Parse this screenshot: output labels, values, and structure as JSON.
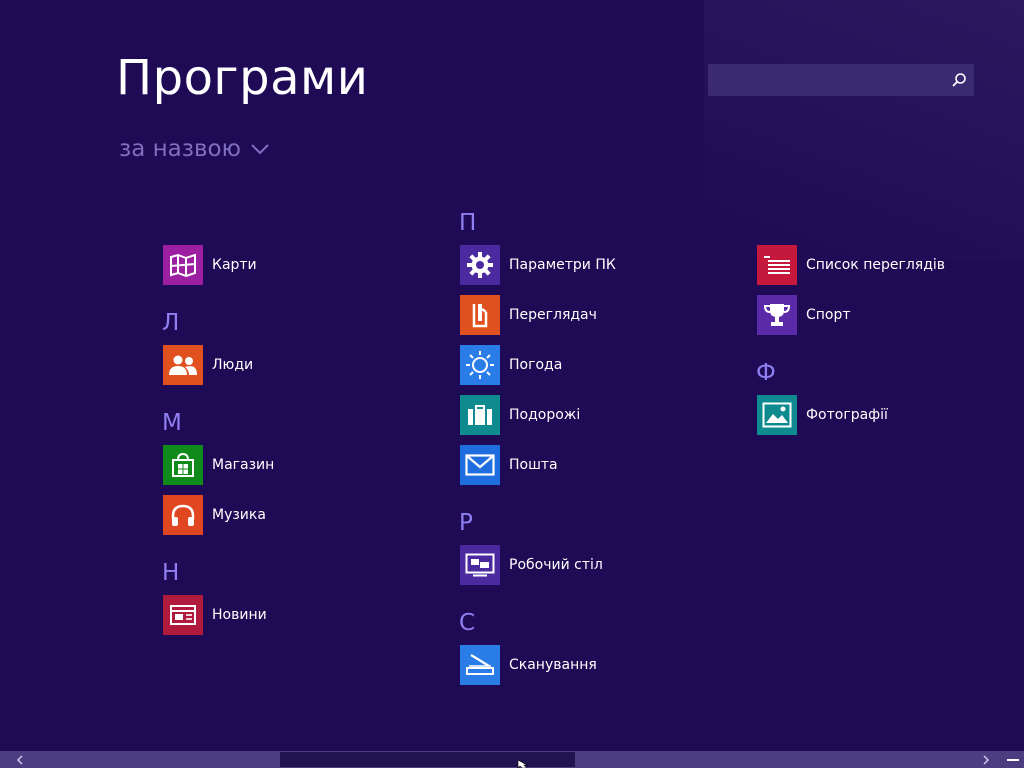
{
  "header": {
    "title": "Програми",
    "sort_label": "за назвою"
  },
  "search": {
    "placeholder": "",
    "icon": "search-icon"
  },
  "groups": {
    "l": "Л",
    "m": "М",
    "n": "Н",
    "p": "П",
    "r": "Р",
    "s": "С",
    "f": "Ф"
  },
  "apps": {
    "karty": {
      "label": "Карти",
      "color": "#9b1fa0",
      "icon": "maps-icon"
    },
    "lyudy": {
      "label": "Люди",
      "color": "#e0511f",
      "icon": "people-icon"
    },
    "mahazyn": {
      "label": "Магазин",
      "color": "#108a1a",
      "icon": "store-icon"
    },
    "muzyka": {
      "label": "Музика",
      "color": "#e0461f",
      "icon": "headphones-icon"
    },
    "novyny": {
      "label": "Новини",
      "color": "#b01a3c",
      "icon": "news-icon"
    },
    "parametry": {
      "label": "Параметри ПК",
      "color": "#4b2aa0",
      "icon": "gear-icon"
    },
    "perehliadach": {
      "label": "Переглядач",
      "color": "#e0511f",
      "icon": "reader-icon"
    },
    "pohoda": {
      "label": "Погода",
      "color": "#2a7ce6",
      "icon": "sun-icon"
    },
    "podorozhi": {
      "label": "Подорожі",
      "color": "#0f8a8f",
      "icon": "suitcase-icon"
    },
    "poshta": {
      "label": "Пошта",
      "color": "#1f6ee0",
      "icon": "mail-icon"
    },
    "robochyi": {
      "label": "Робочий стіл",
      "color": "#4b2aa0",
      "icon": "desktop-icon"
    },
    "skanuvannia": {
      "label": "Сканування",
      "color": "#2a7ce6",
      "icon": "scanner-icon"
    },
    "spysok": {
      "label": "Список переглядів",
      "color": "#c4183c",
      "icon": "list-icon"
    },
    "sport": {
      "label": "Спорт",
      "color": "#5a2aa8",
      "icon": "trophy-icon"
    },
    "foto": {
      "label": "Фотографії",
      "color": "#0f8a8f",
      "icon": "photo-icon"
    }
  },
  "scrollbar": {
    "left_arrow": "chevron-left-icon",
    "right_arrow": "chevron-right-icon",
    "zoom_out": "minus-icon",
    "thumb_start": 0.27,
    "thumb_end": 0.56
  }
}
